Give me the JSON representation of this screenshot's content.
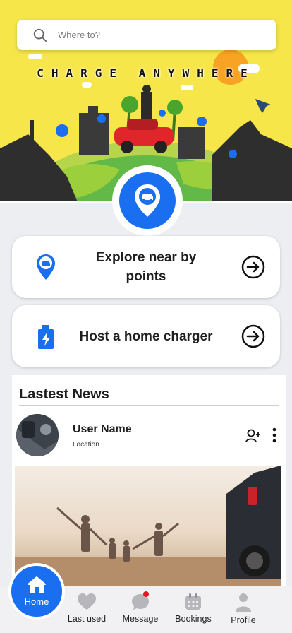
{
  "search": {
    "placeholder": "Where to?",
    "icon": "search-icon"
  },
  "hero": {
    "tagline": "CHARGE ANYWHERE"
  },
  "colors": {
    "accent": "#1a6ff0",
    "hero_bg": "#f6e64a",
    "card_bg": "#ffffff",
    "badge": "#e8151f"
  },
  "cards": [
    {
      "label": "Explore near by points",
      "icon": "ev-location-pin-icon"
    },
    {
      "label": "Host a home charger",
      "icon": "battery-charging-icon"
    }
  ],
  "news": {
    "title": "Lastest News",
    "user_name": "User Name",
    "location": "Location"
  },
  "nav": {
    "home": "Home",
    "last_used": "Last used",
    "message": "Message",
    "bookings": "Bookings",
    "profile": "Profile"
  }
}
